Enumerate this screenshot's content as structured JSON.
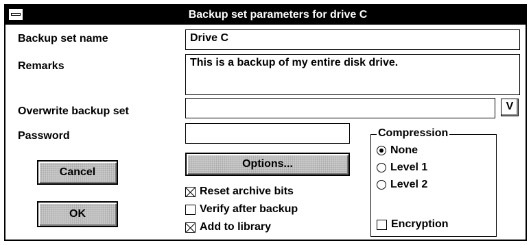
{
  "window": {
    "title": "Backup set parameters for drive C"
  },
  "fields": {
    "name_label": "Backup set name",
    "name_value": "Drive C",
    "remarks_label": "Remarks",
    "remarks_value": "This is a backup of my entire disk drive.",
    "overwrite_label": "Overwrite backup set",
    "overwrite_value": "",
    "overwrite_dropdown_label": "V",
    "password_label": "Password",
    "password_value": ""
  },
  "buttons": {
    "cancel": "Cancel",
    "ok": "OK",
    "options": "Options..."
  },
  "options": [
    {
      "label": "Reset archive bits",
      "checked": true
    },
    {
      "label": "Verify after backup",
      "checked": false
    },
    {
      "label": "Add to library",
      "checked": true
    }
  ],
  "compression": {
    "title": "Compression",
    "choices": [
      {
        "label": "None",
        "selected": true
      },
      {
        "label": "Level 1",
        "selected": false
      },
      {
        "label": "Level 2",
        "selected": false
      }
    ],
    "encryption_label": "Encryption",
    "encryption_checked": false
  }
}
